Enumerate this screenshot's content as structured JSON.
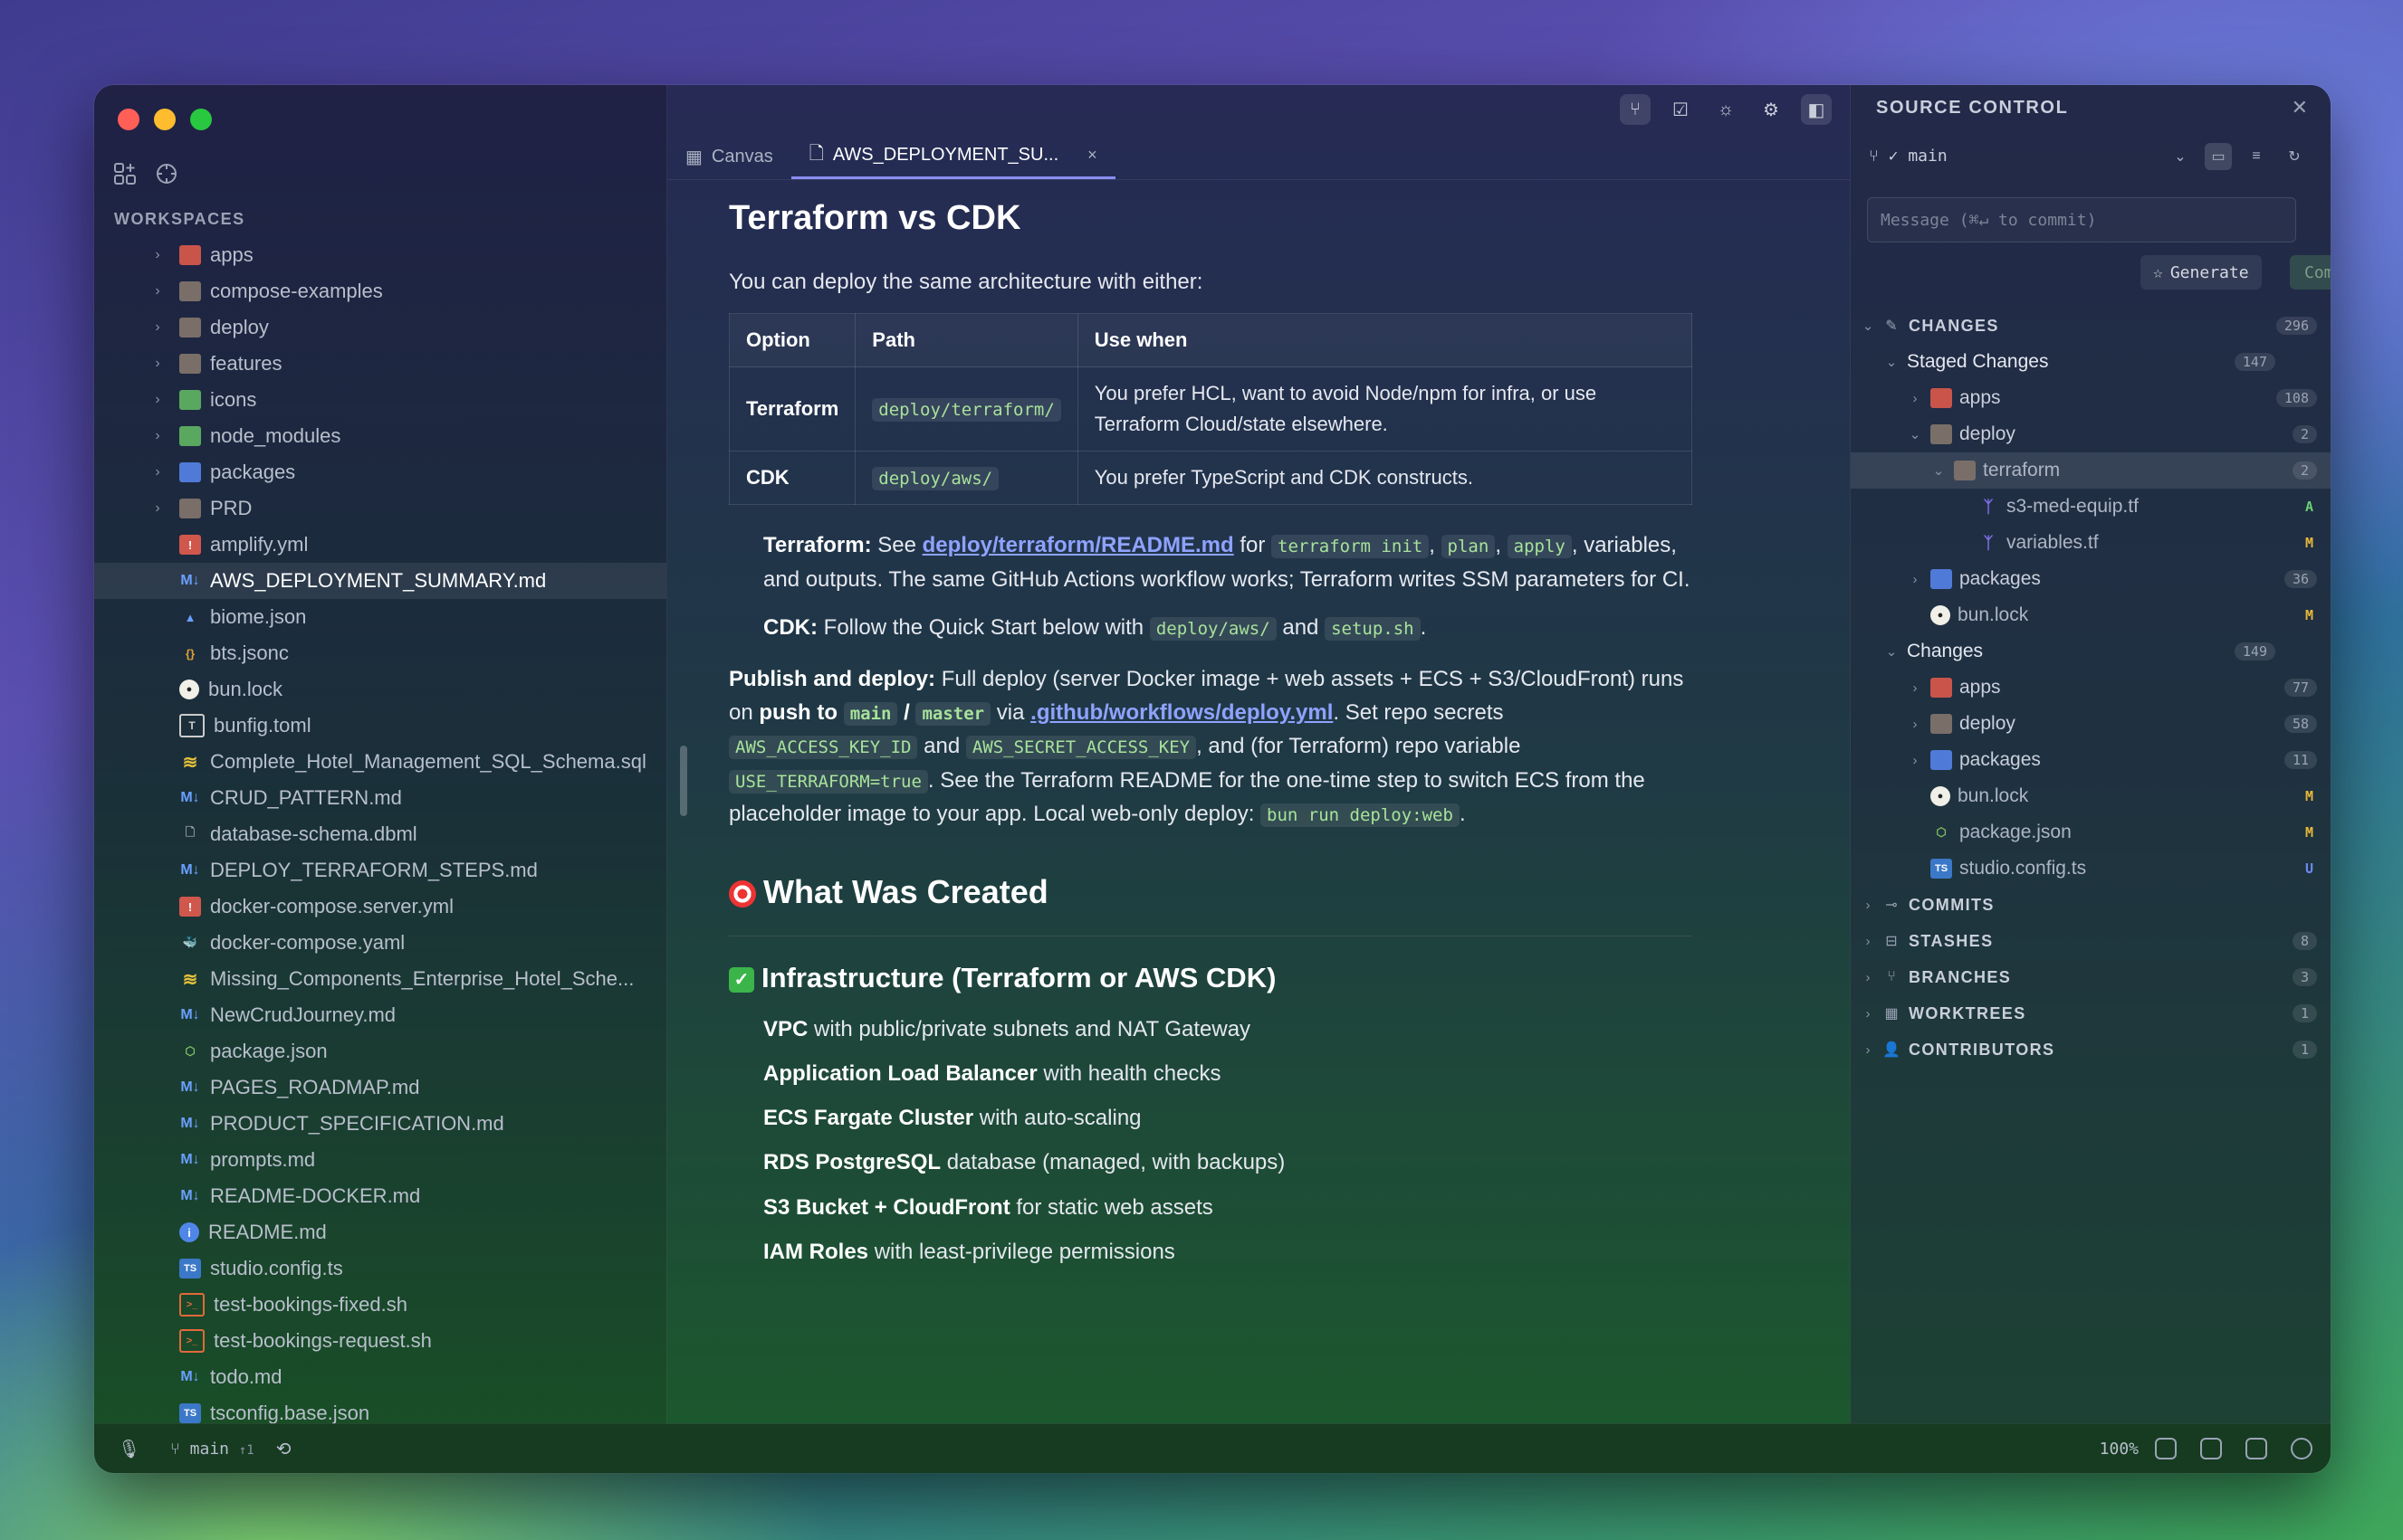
{
  "sidebar": {
    "workspaces_label": "WORKSPACES",
    "items": [
      {
        "label": "apps",
        "type": "folder",
        "color": "red",
        "chevron": true
      },
      {
        "label": "compose-examples",
        "type": "folder",
        "color": "grey",
        "chevron": true
      },
      {
        "label": "deploy",
        "type": "folder",
        "color": "grey",
        "chevron": true
      },
      {
        "label": "features",
        "type": "folder",
        "color": "grey",
        "chevron": true
      },
      {
        "label": "icons",
        "type": "folder",
        "color": "green",
        "chevron": true
      },
      {
        "label": "node_modules",
        "type": "folder",
        "color": "green",
        "chevron": true
      },
      {
        "label": "packages",
        "type": "folder",
        "color": "blue",
        "chevron": true
      },
      {
        "label": "PRD",
        "type": "folder",
        "color": "grey",
        "chevron": true
      },
      {
        "label": "amplify.yml",
        "type": "yml"
      },
      {
        "label": "AWS_DEPLOYMENT_SUMMARY.md",
        "type": "md",
        "active": true
      },
      {
        "label": "biome.json",
        "type": "biome"
      },
      {
        "label": "bts.jsonc",
        "type": "jsonc"
      },
      {
        "label": "bun.lock",
        "type": "bun"
      },
      {
        "label": "bunfig.toml",
        "type": "toml"
      },
      {
        "label": "Complete_Hotel_Management_SQL_Schema.sql",
        "type": "sql"
      },
      {
        "label": "CRUD_PATTERN.md",
        "type": "md"
      },
      {
        "label": "database-schema.dbml",
        "type": "file"
      },
      {
        "label": "DEPLOY_TERRAFORM_STEPS.md",
        "type": "md"
      },
      {
        "label": "docker-compose.server.yml",
        "type": "yml"
      },
      {
        "label": "docker-compose.yaml",
        "type": "docker"
      },
      {
        "label": "Missing_Components_Enterprise_Hotel_Sche...",
        "type": "sql"
      },
      {
        "label": "NewCrudJourney.md",
        "type": "md"
      },
      {
        "label": "package.json",
        "type": "json"
      },
      {
        "label": "PAGES_ROADMAP.md",
        "type": "md"
      },
      {
        "label": "PRODUCT_SPECIFICATION.md",
        "type": "md"
      },
      {
        "label": "prompts.md",
        "type": "md"
      },
      {
        "label": "README-DOCKER.md",
        "type": "md"
      },
      {
        "label": "README.md",
        "type": "info"
      },
      {
        "label": "studio.config.ts",
        "type": "ts"
      },
      {
        "label": "test-bookings-fixed.sh",
        "type": "sh"
      },
      {
        "label": "test-bookings-request.sh",
        "type": "sh"
      },
      {
        "label": "todo.md",
        "type": "md"
      },
      {
        "label": "tsconfig.base.json",
        "type": "ts"
      }
    ]
  },
  "statusbar": {
    "branch": "main",
    "ahead": "↑1",
    "zoom": "100%"
  },
  "tabs": [
    {
      "label": "Canvas",
      "icon": "grid-icon"
    },
    {
      "label": "AWS_DEPLOYMENT_SU...",
      "icon": "file-icon",
      "active": true,
      "close": "×"
    }
  ],
  "doc": {
    "h1": "Terraform vs CDK",
    "intro": "You can deploy the same architecture with either:",
    "table": {
      "headers": [
        "Option",
        "Path",
        "Use when"
      ],
      "rows": [
        {
          "option": "Terraform",
          "path": "deploy/terraform/",
          "use": "You prefer HCL, want to avoid Node/npm for infra, or use Terraform Cloud/state elsewhere."
        },
        {
          "option": "CDK",
          "path": "deploy/aws/",
          "use": "You prefer TypeScript and CDK constructs."
        }
      ]
    },
    "tf_para": {
      "lead": "Terraform:",
      "see": "See",
      "link": "deploy/terraform/README.md",
      "for": "for",
      "c1": "terraform init",
      "c2": "plan",
      "c3": "apply",
      "rest": ", variables, and outputs. The same GitHub Actions workflow works; Terraform writes SSM parameters for CI."
    },
    "cdk_para": {
      "lead": "CDK:",
      "text": "Follow the Quick Start below with",
      "c1": "deploy/aws/",
      "and": "and",
      "c2": "setup.sh",
      "end": "."
    },
    "publish": {
      "lead": "Publish and deploy:",
      "t1": "Full deploy (server Docker image + web assets + ECS + S3/CloudFront) runs on",
      "push": "push to",
      "c_main": "main",
      "slash": "/",
      "c_master": "master",
      "via": "via",
      "link": ".github/workflows/deploy.yml",
      "t2": ". Set repo secrets",
      "c_key": "AWS_ACCESS_KEY_ID",
      "and": "and",
      "c_secret": "AWS_SECRET_ACCESS_KEY",
      "t3": ", and (for Terraform) repo variable",
      "c_var": "USE_TERRAFORM=true",
      "t4": ". See the Terraform README for the one-time step to switch ECS from the placeholder image to your app. Local web-only deploy:",
      "c_cmd": "bun run deploy:web",
      "t5": "."
    },
    "h2": "What Was Created",
    "h3": "Infrastructure (Terraform or AWS CDK)",
    "list": [
      {
        "bold": "VPC",
        "text": "with public/private subnets and NAT Gateway"
      },
      {
        "bold": "Application Load Balancer",
        "text": "with health checks"
      },
      {
        "bold": "ECS Fargate Cluster",
        "text": "with auto-scaling"
      },
      {
        "bold": "RDS PostgreSQL",
        "text": "database (managed, with backups)"
      },
      {
        "bold": "S3 Bucket + CloudFront",
        "text": "for static web assets"
      },
      {
        "bold": "IAM Roles",
        "text": "with least-privilege permissions"
      }
    ]
  },
  "scm": {
    "title": "SOURCE CONTROL",
    "branch": "✓ main",
    "message_placeholder": "Message (⌘↵ to commit)",
    "generate": "Generate",
    "commit": "Commit",
    "changes_label": "CHANGES",
    "changes_count": "296",
    "staged_label": "Staged Changes",
    "staged_count": "147",
    "staged": [
      {
        "label": "apps",
        "count": "108",
        "level": 2,
        "chev": "›",
        "icon": "folder-red"
      },
      {
        "label": "deploy",
        "count": "2",
        "level": 2,
        "chev": "⌄",
        "icon": "folder-grey"
      },
      {
        "label": "terraform",
        "count": "2",
        "level": 3,
        "chev": "⌄",
        "icon": "folder-grey",
        "selected": true
      },
      {
        "label": "s3-med-equip.tf",
        "status": "A",
        "level": 4,
        "icon": "tf"
      },
      {
        "label": "variables.tf",
        "status": "M",
        "level": 4,
        "icon": "tf"
      },
      {
        "label": "packages",
        "count": "36",
        "level": 2,
        "chev": "›",
        "icon": "folder-blue"
      },
      {
        "label": "bun.lock",
        "status": "M",
        "level": 2,
        "icon": "bun"
      }
    ],
    "unstaged_label": "Changes",
    "unstaged_count": "149",
    "unstaged": [
      {
        "label": "apps",
        "count": "77",
        "level": 2,
        "chev": "›",
        "icon": "folder-red"
      },
      {
        "label": "deploy",
        "count": "58",
        "level": 2,
        "chev": "›",
        "icon": "folder-grey"
      },
      {
        "label": "packages",
        "count": "11",
        "level": 2,
        "chev": "›",
        "icon": "folder-blue"
      },
      {
        "label": "bun.lock",
        "status": "M",
        "level": 2,
        "icon": "bun"
      },
      {
        "label": "package.json",
        "status": "M",
        "level": 2,
        "icon": "json"
      },
      {
        "label": "studio.config.ts",
        "status": "U",
        "level": 2,
        "icon": "ts"
      }
    ],
    "sections": [
      {
        "label": "COMMITS",
        "count": ""
      },
      {
        "label": "STASHES",
        "count": "8"
      },
      {
        "label": "BRANCHES",
        "count": "3"
      },
      {
        "label": "WORKTREES",
        "count": "1"
      },
      {
        "label": "CONTRIBUTORS",
        "count": "1"
      }
    ]
  }
}
